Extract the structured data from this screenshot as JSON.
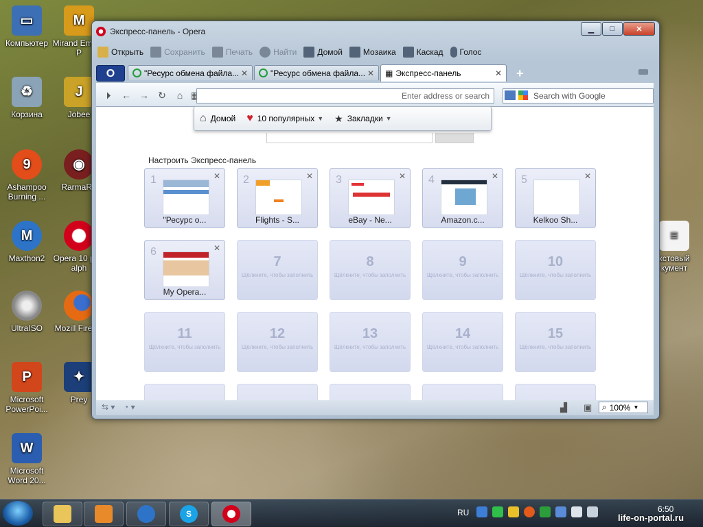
{
  "desktop": {
    "icons_col1": [
      {
        "label": "Компьютер",
        "icon": "computer-icon",
        "color": "#3d6fb5"
      },
      {
        "label": "Корзина",
        "icon": "recycle-bin-icon",
        "color": "#8aa3b7"
      },
      {
        "label": "Ashampoo Burning ...",
        "icon": "ashampoo-icon",
        "color": "#e24d1a"
      },
      {
        "label": "Maxthon2",
        "icon": "maxthon-icon",
        "color": "#2d74c9"
      },
      {
        "label": "UltraISO",
        "icon": "ultraiso-icon",
        "color": "#8d8d8d"
      },
      {
        "label": "Microsoft PowerPoi...",
        "icon": "powerpoint-icon",
        "color": "#d2461c"
      },
      {
        "label": "Microsoft Word 20...",
        "icon": "word-icon",
        "color": "#2b5eb0"
      }
    ],
    "icons_col2": [
      {
        "label": "Mirand Empoli P",
        "icon": "miranda-icon",
        "color": "#d79a1b"
      },
      {
        "label": "Jobee",
        "icon": "jobee-icon",
        "color": "#c9a227"
      },
      {
        "label": "RarmaRa",
        "icon": "radio-icon",
        "color": "#7a1f1f"
      },
      {
        "label": "Opera 10 pre-alph",
        "icon": "opera-icon",
        "color": "#d3001b"
      },
      {
        "label": "Mozill Firefox",
        "icon": "firefox-icon",
        "color": "#e66a12"
      },
      {
        "label": "Prey",
        "icon": "prey-icon",
        "color": "#1c3f7a"
      }
    ],
    "right_icon": {
      "label": "кстовый кумент",
      "icon": "text-document-icon"
    }
  },
  "window": {
    "title": "Экспресс-панель - Opera",
    "menu": [
      {
        "label": "Открыть",
        "icon": "folder-icon",
        "enabled": true
      },
      {
        "label": "Сохранить",
        "icon": "save-icon",
        "enabled": false
      },
      {
        "label": "Печать",
        "icon": "print-icon",
        "enabled": false
      },
      {
        "label": "Найти",
        "icon": "find-icon",
        "enabled": false
      },
      {
        "label": "Домой",
        "icon": "home-icon",
        "enabled": true
      },
      {
        "label": "Мозаика",
        "icon": "tile-icon",
        "enabled": true
      },
      {
        "label": "Каскад",
        "icon": "cascade-icon",
        "enabled": true
      },
      {
        "label": "Голос",
        "icon": "microphone-icon",
        "enabled": true
      }
    ],
    "tabs": [
      {
        "label": "\"Ресурс обмена файла...",
        "active": false
      },
      {
        "label": "\"Ресурс обмена файла...",
        "active": false
      },
      {
        "label": "Экспресс-панель",
        "active": true
      }
    ],
    "address": {
      "value": "",
      "placeholder": "Enter address or search"
    },
    "search": {
      "placeholder": "Search with Google"
    },
    "dropdown": {
      "home": "Домой",
      "popular": "10 популярных",
      "bookmarks": "Закладки"
    },
    "speed_dial_setup": "Настроить Экспресс-панель",
    "dials": [
      {
        "num": "1",
        "title": "\"Ресурс о..."
      },
      {
        "num": "2",
        "title": "Flights - S..."
      },
      {
        "num": "3",
        "title": "eBay - Ne..."
      },
      {
        "num": "4",
        "title": "Amazon.c..."
      },
      {
        "num": "5",
        "title": "Kelkoo Sh..."
      },
      {
        "num": "6",
        "title": "My Opera..."
      }
    ],
    "empty_dials": [
      "7",
      "8",
      "9",
      "10",
      "11",
      "12",
      "13",
      "14",
      "15"
    ],
    "empty_hint": "Щёлкните, чтобы заполнить",
    "zoom": "100%"
  },
  "taskbar": {
    "lang": "RU",
    "clock": "6:50"
  },
  "watermark": "life-on-portal.ru"
}
